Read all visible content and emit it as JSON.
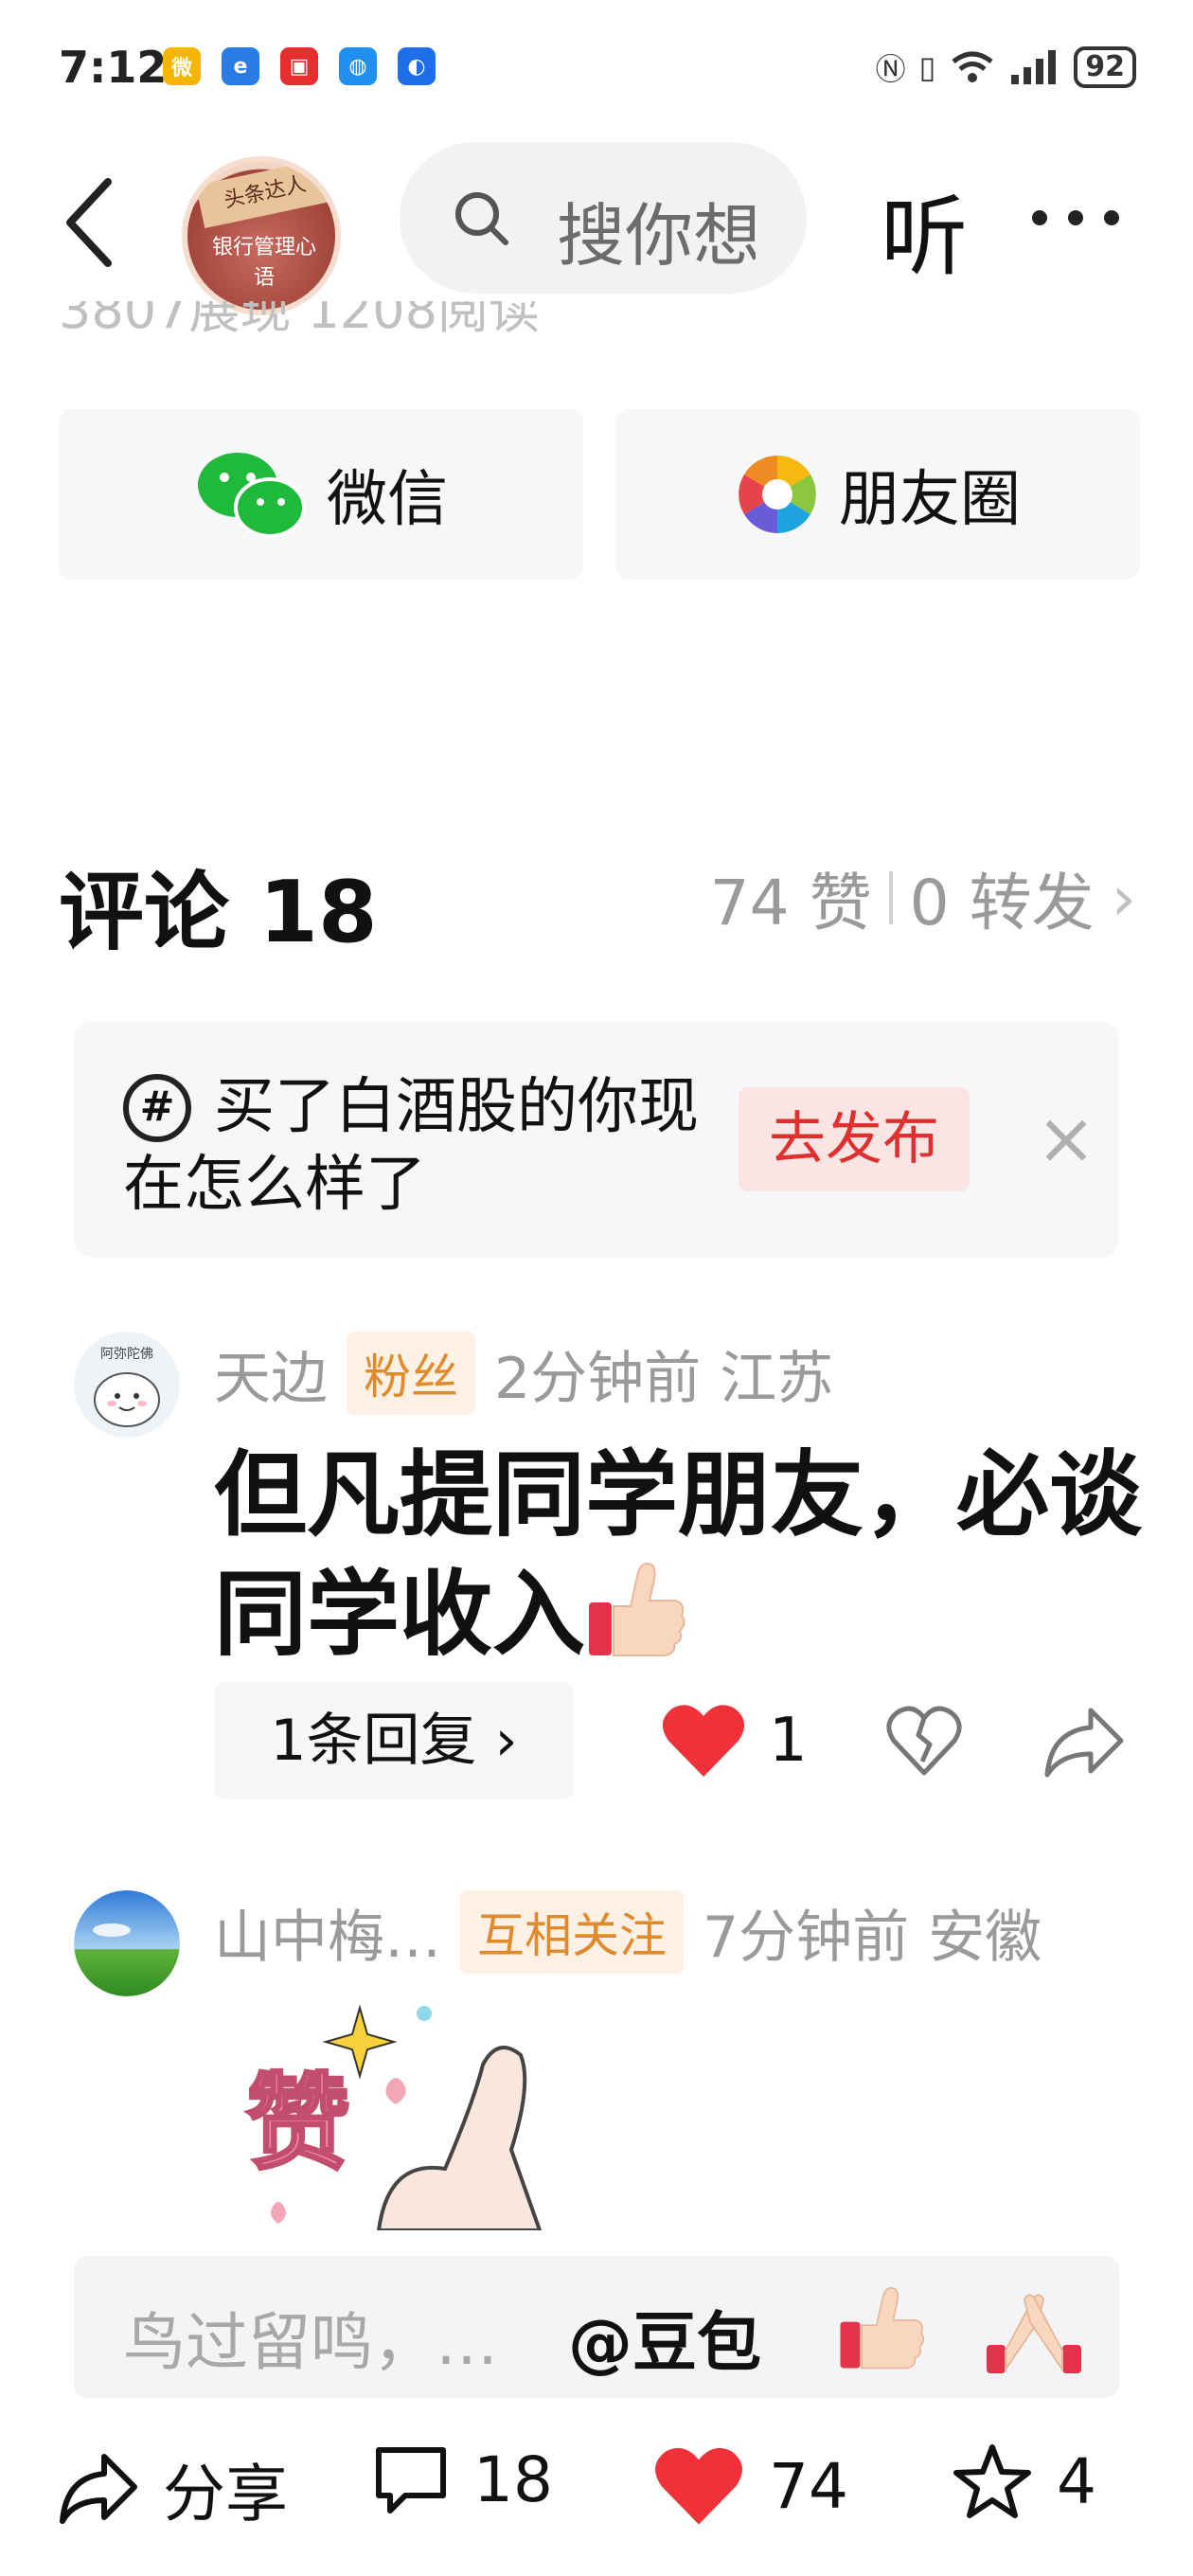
{
  "status_bar": {
    "time": "7:12",
    "battery": "92"
  },
  "header": {
    "search_placeholder": "搜你想",
    "listen_label": "听"
  },
  "article": {
    "stats_faded": "3807展现 1208阅读"
  },
  "share": {
    "wechat_label": "微信",
    "moments_label": "朋友圈"
  },
  "comments": {
    "title": "评论 18",
    "likes": "74 赞",
    "forwards": "0 转发",
    "topic": {
      "text": "买了白酒股的你现在怎么样了",
      "publish_label": "去发布",
      "close_icon": "×"
    },
    "items": [
      {
        "author": "天边",
        "tag": "粉丝",
        "time": "2分钟前",
        "location": "江苏",
        "text": "但凡提同学朋友，必谈同学收入",
        "replies_label": "1条回复 ›",
        "like_count": "1"
      },
      {
        "author": "山中梅…",
        "tag": "互相关注",
        "time": "7分钟前",
        "location": "安徽"
      }
    ]
  },
  "input": {
    "placeholder": "鸟过留鸣，…",
    "mention": "@豆包"
  },
  "bottom_bar": {
    "share_label": "分享",
    "comment_count": "18",
    "like_count": "74",
    "fav_count": "4"
  }
}
